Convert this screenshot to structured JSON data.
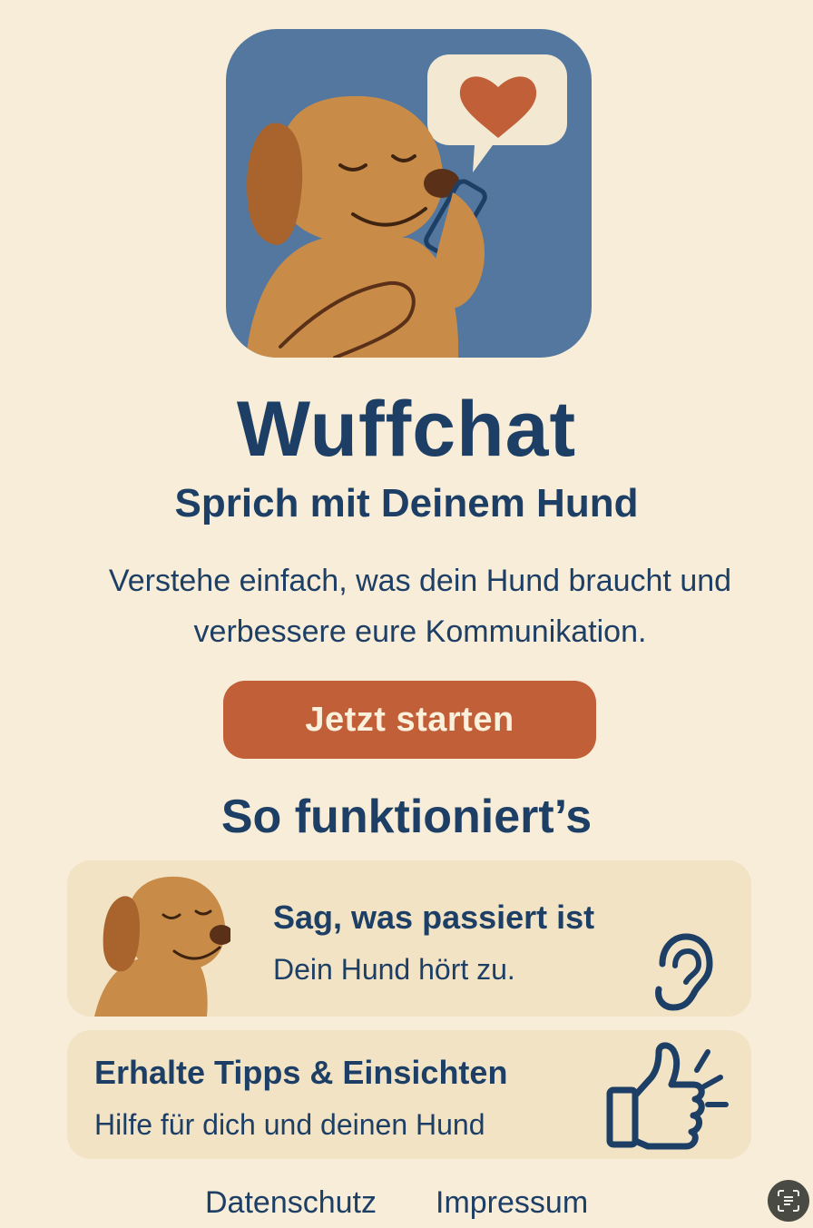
{
  "app": {
    "name": "Wuffchat"
  },
  "hero": {
    "subtitle": "Sprich mit Deinem Hund",
    "description": "Verstehe einfach, was dein Hund braucht und verbessere eure Kommunikation.",
    "cta_label": "Jetzt starten"
  },
  "how_it_works": {
    "heading": "So funktioniert’s",
    "steps": [
      {
        "title": "Sag, was passiert ist",
        "text": "Dein Hund hört zu.",
        "icon": "ear-icon"
      },
      {
        "title": "Erhalte Tipps & Einsichten",
        "text": "Hilfe für dich und deinen Hund",
        "icon": "thumbs-up-icon"
      }
    ]
  },
  "footer": {
    "privacy_label": "Datenschutz",
    "imprint_label": "Impressum"
  },
  "colors": {
    "background": "#f8edd8",
    "primary_text": "#1d3f66",
    "accent": "#c15f38",
    "card": "#f2e3c5",
    "icon_bg": "#53779e",
    "dog": "#c98c48"
  }
}
